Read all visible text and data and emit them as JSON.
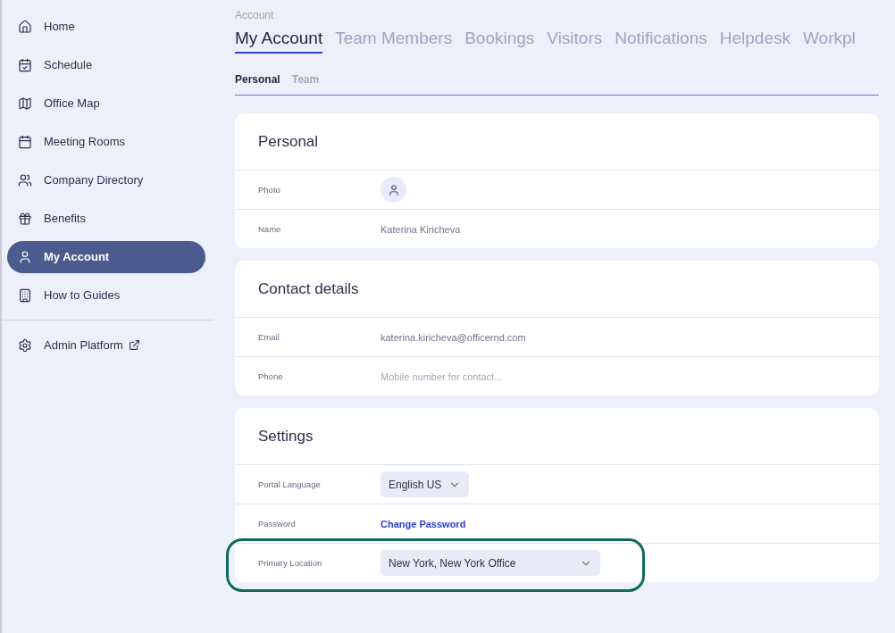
{
  "sidebar": {
    "items": [
      {
        "label": "Home",
        "selected": false
      },
      {
        "label": "Schedule",
        "selected": false
      },
      {
        "label": "Office Map",
        "selected": false
      },
      {
        "label": "Meeting Rooms",
        "selected": false
      },
      {
        "label": "Company Directory",
        "selected": false
      },
      {
        "label": "Benefits",
        "selected": false
      },
      {
        "label": "My Account",
        "selected": true
      },
      {
        "label": "How to Guides",
        "selected": false
      }
    ],
    "footer_items": [
      {
        "label": "Admin Platform",
        "external": true
      }
    ]
  },
  "breadcrumb": "Account",
  "tabs": [
    {
      "label": "My Account",
      "selected": true
    },
    {
      "label": "Team Members",
      "selected": false
    },
    {
      "label": "Bookings",
      "selected": false
    },
    {
      "label": "Visitors",
      "selected": false
    },
    {
      "label": "Notifications",
      "selected": false
    },
    {
      "label": "Helpdesk",
      "selected": false
    },
    {
      "label": "Workpl",
      "selected": false
    }
  ],
  "subtabs": [
    {
      "label": "Personal",
      "selected": true
    },
    {
      "label": "Team",
      "selected": false
    }
  ],
  "sections": [
    {
      "title": "Personal",
      "rows": [
        {
          "label": "Photo",
          "kind": "photo",
          "highlighted": false
        },
        {
          "label": "Name",
          "kind": "text",
          "value": "Katerina Kiricheva",
          "highlighted": false
        }
      ]
    },
    {
      "title": "Contact details",
      "rows": [
        {
          "label": "Email",
          "kind": "text",
          "value": "katerina.kiricheva@officernd.com",
          "highlighted": false
        },
        {
          "label": "Phone",
          "kind": "input",
          "placeholder": "Mobile number for contact...",
          "highlighted": false
        }
      ]
    },
    {
      "title": "Settings",
      "rows": [
        {
          "label": "Portal Language",
          "kind": "select",
          "value": "English US",
          "highlighted": false
        },
        {
          "label": "Password",
          "kind": "link",
          "value": "Change Password",
          "highlighted": false
        },
        {
          "label": "Primary Location",
          "kind": "wideselect",
          "value": "New York, New York Office",
          "highlighted": true
        }
      ]
    }
  ]
}
